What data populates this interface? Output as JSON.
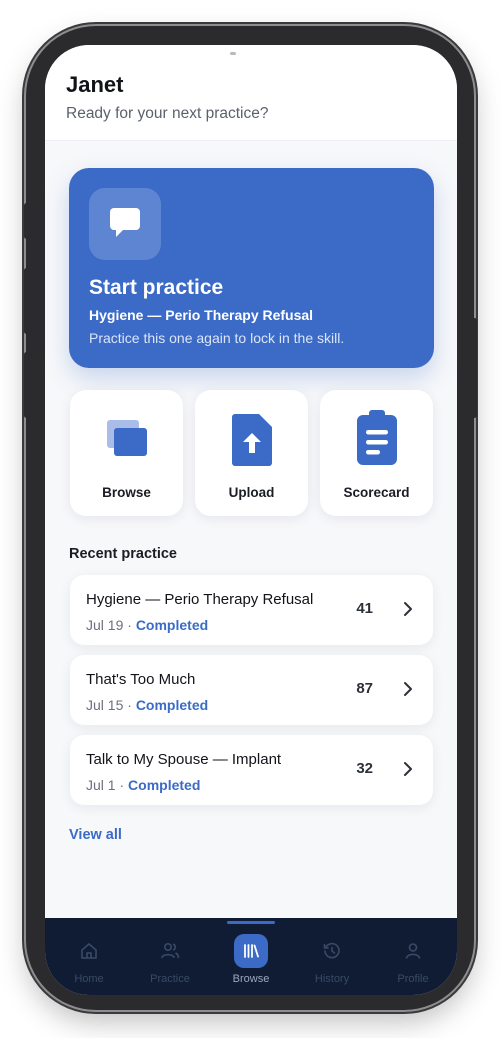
{
  "header": {
    "user_name": "Janet",
    "subtitle": "Ready for your next practice?"
  },
  "hero": {
    "title": "Start practice",
    "scenario": "Hygiene — Perio Therapy Refusal",
    "description": "Practice this one again to lock in the skill.",
    "icon": "chat-bubble-icon"
  },
  "actions": [
    {
      "label": "Browse",
      "icon": "browse-cards-icon"
    },
    {
      "label": "Upload",
      "icon": "upload-file-icon"
    },
    {
      "label": "Scorecard",
      "icon": "clipboard-icon"
    }
  ],
  "recent": {
    "title": "Recent practice",
    "items": [
      {
        "title": "Hygiene — Perio Therapy Refusal",
        "date": "Jul 19",
        "separator": " · ",
        "status": "Completed",
        "score": "41"
      },
      {
        "title": "That's Too Much",
        "date": "Jul 15",
        "separator": " · ",
        "status": "Completed",
        "score": "87"
      },
      {
        "title": "Talk to My Spouse — Implant",
        "date": "Jul 1",
        "separator": " · ",
        "status": "Completed",
        "score": "32"
      }
    ],
    "view_all": "View all"
  },
  "tabbar": {
    "active": "Browse",
    "tabs": [
      {
        "label": "Home",
        "icon": "home-icon"
      },
      {
        "label": "Practice",
        "icon": "users-icon"
      },
      {
        "label": "Browse",
        "icon": "library-icon"
      },
      {
        "label": "History",
        "icon": "history-icon"
      },
      {
        "label": "Profile",
        "icon": "user-icon"
      }
    ]
  },
  "colors": {
    "accent": "#3b6bc7",
    "tabbar_bg": "#0f1c33",
    "background": "#f7f8fa"
  }
}
